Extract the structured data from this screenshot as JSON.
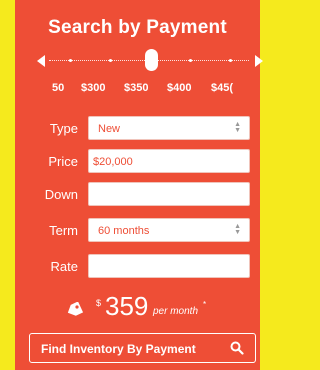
{
  "widget": {
    "title": "Search by Payment",
    "slider": {
      "ticks": [
        "50",
        "$300",
        "$350",
        "$400",
        "$45("
      ],
      "value": 350
    },
    "form": {
      "type": {
        "label": "Type",
        "value": "New"
      },
      "price": {
        "label": "Price",
        "value": "$20,000"
      },
      "down": {
        "label": "Down",
        "value": ""
      },
      "term": {
        "label": "Term",
        "value": "60 months"
      },
      "rate": {
        "label": "Rate",
        "value": ""
      }
    },
    "result": {
      "currency": "$",
      "amount": "359",
      "per": "per month",
      "footnote": "*"
    },
    "find_button": {
      "label": "Find Inventory By Payment"
    }
  },
  "colors": {
    "background": "#f5ea1d",
    "panel": "#ee4e36",
    "text": "#ffffff"
  },
  "icons": {
    "tag": "price-tag-icon",
    "search": "search-icon"
  }
}
